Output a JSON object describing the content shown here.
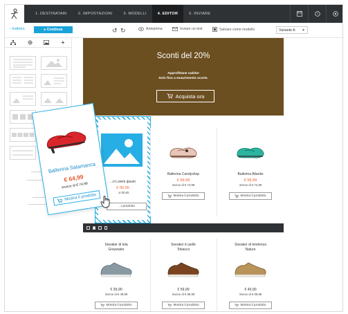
{
  "nav": {
    "steps": [
      {
        "label": "1. DESTINATARI"
      },
      {
        "label": "2. IMPOSTAZIONI"
      },
      {
        "label": "3. MODELLI"
      },
      {
        "label": "4. EDITOR"
      },
      {
        "label": "5. INVIARE"
      }
    ],
    "active_step": 3,
    "icons": [
      "save-icon",
      "help-icon",
      "settings-icon"
    ]
  },
  "toolbar": {
    "back_label": "Indietro",
    "continue_label": "Continua",
    "preview_label": "Anteprima",
    "test_label": "Inviare un test",
    "save_model_label": "Salvare come modello",
    "variant_value": "Variante A"
  },
  "hero": {
    "title": "Sconti del 20%",
    "subtitle_line1": "Approfittane subito!",
    "subtitle_line2": "Solo fino a esaurimento scorte.",
    "cta_label": "Acquista ora",
    "bg_color": "#6b4f21"
  },
  "products_row1": [
    {
      "name": "...ti Lorem ipsum",
      "price": "€ 00,00",
      "old_price": "...€ 00,00",
      "button": "...i prodotto"
    },
    {
      "name": "Ballerina Candyshop",
      "price": "€ 59,99",
      "old_price": "invece di € 74,99",
      "button": "Mostra il prodotto"
    },
    {
      "name": "Ballerina Atlantis",
      "price": "€ 59,99",
      "old_price": "invece di € 74,99",
      "button": "Mostra il prodotto"
    }
  ],
  "products_row2": [
    {
      "name1": "Sneaker di tela",
      "name2": "Greywater",
      "price": "€ 39,90",
      "old_price": "invece di € 49,99",
      "button": "Mostra il prodotto"
    },
    {
      "name1": "Sneaker in pelle",
      "name2": "Tobacco",
      "price": "€ 59,99",
      "old_price": "invece di € 89,99",
      "button": "Mostra il prodotto"
    },
    {
      "name1": "Sneaker di tendenza",
      "name2": "Nature",
      "price": "€ 49,90",
      "old_price": "invece di € 69,99",
      "button": "Mostra il prodotto"
    }
  ],
  "drag_card": {
    "name": "Ballerina Salamanca",
    "price": "€ 64,99",
    "old_price": "invece di € 74,99",
    "button": "Mostra il prodotto"
  },
  "colors": {
    "accent": "#1aa3d9",
    "price": "#e85a2a",
    "dark": "#2f3235"
  }
}
